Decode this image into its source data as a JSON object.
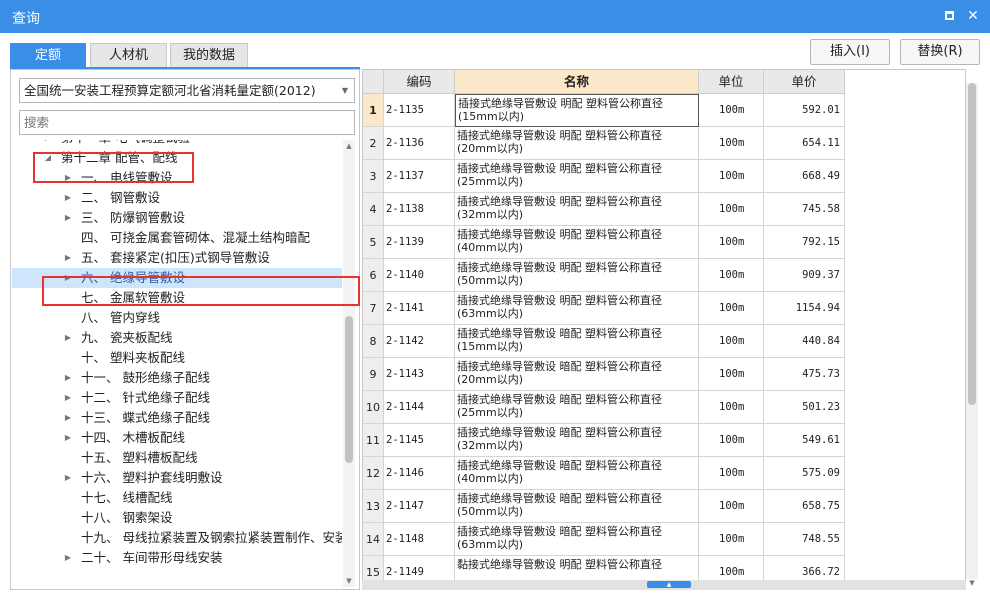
{
  "window": {
    "title": "查询",
    "max_glyph": "□",
    "close_glyph": "✕"
  },
  "tabs": [
    {
      "label": "定额",
      "active": true
    },
    {
      "label": "人材机",
      "active": false
    },
    {
      "label": "我的数据",
      "active": false
    }
  ],
  "actions": {
    "insert_label": "插入(I)",
    "replace_label": "替换(R)"
  },
  "left": {
    "dropdown_value": "全国统一安装工程预算定额河北省消耗量定额(2012)",
    "search_placeholder": "搜索",
    "tree": [
      {
        "label": "第十一章 电气调整试验",
        "toggle": "▶",
        "level": 0
      },
      {
        "label": "第十二章 配管、配线",
        "toggle": "◢",
        "level": 0
      },
      {
        "label": "一、 电线管敷设",
        "toggle": "▶",
        "level": 1
      },
      {
        "label": "二、 钢管敷设",
        "toggle": "▶",
        "level": 1
      },
      {
        "label": "三、 防爆钢管敷设",
        "toggle": "▶",
        "level": 1
      },
      {
        "label": "四、 可挠金属套管砌体、混凝土结构暗配",
        "toggle": "",
        "level": 1
      },
      {
        "label": "五、 套接紧定(扣压)式钢导管敷设",
        "toggle": "▶",
        "level": 1
      },
      {
        "label": "六、 绝缘导管敷设",
        "toggle": "▶",
        "level": 1,
        "selected": true
      },
      {
        "label": "七、 金属软管敷设",
        "toggle": "",
        "level": 1
      },
      {
        "label": "八、 管内穿线",
        "toggle": "",
        "level": 1
      },
      {
        "label": "九、 瓷夹板配线",
        "toggle": "▶",
        "level": 1
      },
      {
        "label": "十、 塑料夹板配线",
        "toggle": "",
        "level": 1
      },
      {
        "label": "十一、 鼓形绝缘子配线",
        "toggle": "▶",
        "level": 1
      },
      {
        "label": "十二、 针式绝缘子配线",
        "toggle": "▶",
        "level": 1
      },
      {
        "label": "十三、 蝶式绝缘子配线",
        "toggle": "▶",
        "level": 1
      },
      {
        "label": "十四、 木槽板配线",
        "toggle": "▶",
        "level": 1
      },
      {
        "label": "十五、 塑料槽板配线",
        "toggle": "",
        "level": 1
      },
      {
        "label": "十六、 塑料护套线明敷设",
        "toggle": "▶",
        "level": 1
      },
      {
        "label": "十七、 线槽配线",
        "toggle": "",
        "level": 1
      },
      {
        "label": "十八、 钢索架设",
        "toggle": "",
        "level": 1
      },
      {
        "label": "十九、 母线拉紧装置及钢索拉紧装置制作、安装",
        "toggle": "",
        "level": 1
      },
      {
        "label": "二十、 车间带形母线安装",
        "toggle": "▶",
        "level": 1
      }
    ]
  },
  "table": {
    "columns": [
      "",
      "编码",
      "名称",
      "单位",
      "单价"
    ],
    "rows": [
      {
        "no": "1",
        "code": "2-1135",
        "name": "插接式绝缘导管敷设 明配 塑料管公称直径(15mm以内)",
        "unit": "100m",
        "price": "592.01"
      },
      {
        "no": "2",
        "code": "2-1136",
        "name": "插接式绝缘导管敷设 明配 塑料管公称直径(20mm以内)",
        "unit": "100m",
        "price": "654.11"
      },
      {
        "no": "3",
        "code": "2-1137",
        "name": "插接式绝缘导管敷设 明配 塑料管公称直径(25mm以内)",
        "unit": "100m",
        "price": "668.49"
      },
      {
        "no": "4",
        "code": "2-1138",
        "name": "插接式绝缘导管敷设 明配 塑料管公称直径(32mm以内)",
        "unit": "100m",
        "price": "745.58"
      },
      {
        "no": "5",
        "code": "2-1139",
        "name": "插接式绝缘导管敷设 明配 塑料管公称直径(40mm以内)",
        "unit": "100m",
        "price": "792.15"
      },
      {
        "no": "6",
        "code": "2-1140",
        "name": "插接式绝缘导管敷设 明配 塑料管公称直径(50mm以内)",
        "unit": "100m",
        "price": "909.37"
      },
      {
        "no": "7",
        "code": "2-1141",
        "name": "插接式绝缘导管敷设 明配 塑料管公称直径(63mm以内)",
        "unit": "100m",
        "price": "1154.94"
      },
      {
        "no": "8",
        "code": "2-1142",
        "name": "插接式绝缘导管敷设 暗配 塑料管公称直径(15mm以内)",
        "unit": "100m",
        "price": "440.84"
      },
      {
        "no": "9",
        "code": "2-1143",
        "name": "插接式绝缘导管敷设 暗配 塑料管公称直径(20mm以内)",
        "unit": "100m",
        "price": "475.73"
      },
      {
        "no": "10",
        "code": "2-1144",
        "name": "插接式绝缘导管敷设 暗配 塑料管公称直径(25mm以内)",
        "unit": "100m",
        "price": "501.23"
      },
      {
        "no": "11",
        "code": "2-1145",
        "name": "插接式绝缘导管敷设 暗配 塑料管公称直径(32mm以内)",
        "unit": "100m",
        "price": "549.61"
      },
      {
        "no": "12",
        "code": "2-1146",
        "name": "插接式绝缘导管敷设 暗配 塑料管公称直径(40mm以内)",
        "unit": "100m",
        "price": "575.09"
      },
      {
        "no": "13",
        "code": "2-1147",
        "name": "插接式绝缘导管敷设 暗配 塑料管公称直径(50mm以内)",
        "unit": "100m",
        "price": "658.75"
      },
      {
        "no": "14",
        "code": "2-1148",
        "name": "插接式绝缘导管敷设 暗配 塑料管公称直径(63mm以内)",
        "unit": "100m",
        "price": "748.55"
      },
      {
        "no": "15",
        "code": "2-1149",
        "name": "黏接式绝缘导管敷设 明配 塑料管公称直径",
        "unit": "100m",
        "price": "366.72"
      }
    ]
  },
  "colors": {
    "accent": "#3a8ee6",
    "highlight_box": "#e8322e",
    "selected_row": "#cde6fb",
    "header_current": "#fbe8c8"
  }
}
